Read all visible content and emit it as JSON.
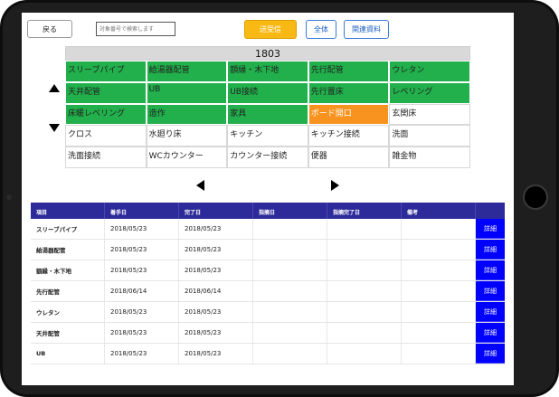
{
  "toolbar": {
    "back_label": "戻る",
    "search_placeholder": "対象番号で検索します",
    "send_label": "送受信",
    "all_label": "全体",
    "docs_label": "関連資料"
  },
  "colors": {
    "done": "#21b04b",
    "in_progress": "#f7931e",
    "send_button": "#f9b915",
    "table_header": "#2d2a9a",
    "detail_button": "#0000ff"
  },
  "room": {
    "number": "1803",
    "tasks": [
      {
        "label": "スリーブパイプ",
        "status": "green"
      },
      {
        "label": "給湯器配管",
        "status": "green"
      },
      {
        "label": "額縁・木下地",
        "status": "green"
      },
      {
        "label": "先行配管",
        "status": "green"
      },
      {
        "label": "ウレタン",
        "status": "green"
      },
      {
        "label": "天井配管",
        "status": "green"
      },
      {
        "label": "UB",
        "status": "green"
      },
      {
        "label": "UB接続",
        "status": "green"
      },
      {
        "label": "先行置床",
        "status": "green"
      },
      {
        "label": "レベリング",
        "status": "green"
      },
      {
        "label": "床暖レベリング",
        "status": "green"
      },
      {
        "label": "造作",
        "status": "green"
      },
      {
        "label": "家具",
        "status": "green"
      },
      {
        "label": "ボード開口",
        "status": "orange"
      },
      {
        "label": "玄関床",
        "status": "white"
      },
      {
        "label": "クロス",
        "status": "white"
      },
      {
        "label": "水廻り床",
        "status": "white"
      },
      {
        "label": "キッチン",
        "status": "white"
      },
      {
        "label": "キッチン接続",
        "status": "white"
      },
      {
        "label": "洗面",
        "status": "white"
      },
      {
        "label": "洗面接続",
        "status": "white"
      },
      {
        "label": "WCカウンター",
        "status": "white"
      },
      {
        "label": "カウンター接続",
        "status": "white"
      },
      {
        "label": "便器",
        "status": "white"
      },
      {
        "label": "雑金物",
        "status": "white"
      }
    ]
  },
  "nav": {
    "up_icon": "triangle-up-icon",
    "down_icon": "triangle-down-icon",
    "left_icon": "triangle-left-icon",
    "right_icon": "triangle-right-icon"
  },
  "schedule": {
    "headers": [
      "項目",
      "着手日",
      "完了日",
      "指摘日",
      "指摘完了日",
      "備考",
      ""
    ],
    "detail_label": "詳細",
    "rows": [
      {
        "item": "スリーブパイプ",
        "start": "2018/05/23",
        "end": "2018/05/23",
        "issue": "",
        "issue_done": "",
        "note": ""
      },
      {
        "item": "給湯器配管",
        "start": "2018/05/23",
        "end": "2018/05/23",
        "issue": "",
        "issue_done": "",
        "note": ""
      },
      {
        "item": "額縁・木下地",
        "start": "2018/05/23",
        "end": "2018/05/23",
        "issue": "",
        "issue_done": "",
        "note": ""
      },
      {
        "item": "先行配管",
        "start": "2018/06/14",
        "end": "2018/06/14",
        "issue": "",
        "issue_done": "",
        "note": ""
      },
      {
        "item": "ウレタン",
        "start": "2018/05/23",
        "end": "2018/05/23",
        "issue": "",
        "issue_done": "",
        "note": ""
      },
      {
        "item": "天井配管",
        "start": "2018/05/23",
        "end": "2018/05/23",
        "issue": "",
        "issue_done": "",
        "note": ""
      },
      {
        "item": "UB",
        "start": "2018/05/23",
        "end": "2018/05/23",
        "issue": "",
        "issue_done": "",
        "note": ""
      }
    ]
  }
}
